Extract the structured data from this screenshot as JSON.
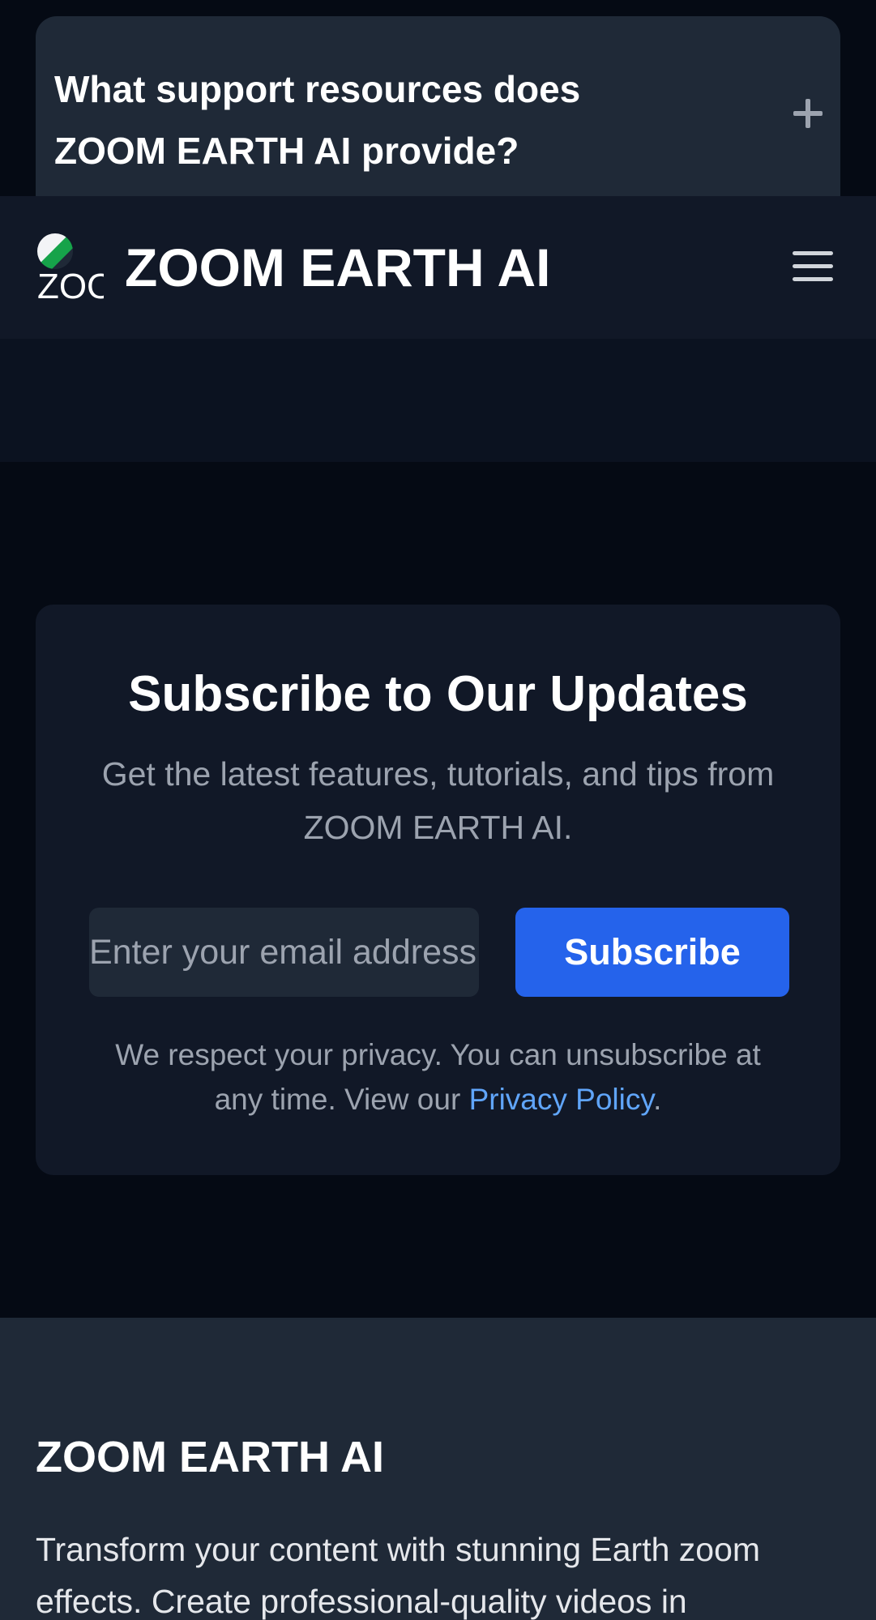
{
  "faq": {
    "question": "What support resources does ZOOM EARTH AI provide?",
    "toggle_icon": "plus-icon"
  },
  "header": {
    "logo_text": "ZOOM",
    "brand": "ZOOM EARTH AI",
    "menu_icon": "hamburger-icon"
  },
  "subscribe": {
    "title": "Subscribe to Our Updates",
    "description": "Get the latest features, tutorials, and tips from ZOOM EARTH AI.",
    "email_placeholder": "Enter your email address",
    "button_label": "Subscribe",
    "privacy_prefix": "We respect your privacy. You can unsubscribe at any time. View our ",
    "privacy_link": "Privacy Policy",
    "privacy_suffix": "."
  },
  "footer": {
    "title": "ZOOM EARTH AI",
    "description": "Transform your content with stunning Earth zoom effects. Create professional-quality videos in"
  },
  "colors": {
    "accent": "#2563eb",
    "link": "#60a5fa",
    "card": "#1f2937",
    "background": "#050a14"
  }
}
